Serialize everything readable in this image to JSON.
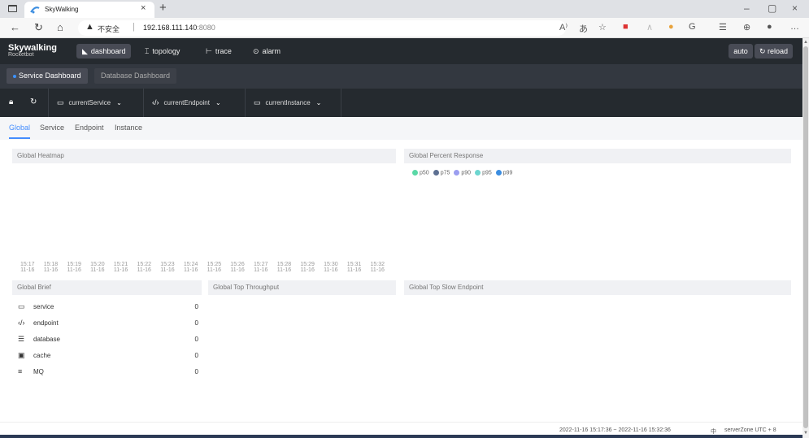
{
  "browser": {
    "tab_title": "SkyWalking",
    "url_warning": "不安全",
    "url_host": "192.168.111.140",
    "url_port": ":8080"
  },
  "app": {
    "logo_title": "Skywalking",
    "logo_subtitle": "Rocketbot",
    "nav": [
      {
        "label": "dashboard",
        "icon": "dashboard-icon"
      },
      {
        "label": "topology",
        "icon": "topology-icon"
      },
      {
        "label": "trace",
        "icon": "trace-icon"
      },
      {
        "label": "alarm",
        "icon": "alarm-icon"
      }
    ],
    "auto_label": "auto",
    "reload_label": "reload"
  },
  "dashboard_tabs": [
    "Service Dashboard",
    "Database Dashboard"
  ],
  "toolbar": {
    "service": "currentService",
    "endpoint": "currentEndpoint",
    "instance": "currentInstance"
  },
  "content_tabs": [
    "Global",
    "Service",
    "Endpoint",
    "Instance"
  ],
  "panels": {
    "heatmap": "Global Heatmap",
    "percent": "Global Percent Response",
    "brief": "Global Brief",
    "throughput": "Global Top Throughput",
    "slow": "Global Top Slow Endpoint"
  },
  "heatmap_times": [
    {
      "t": "15:17",
      "d": "11-16"
    },
    {
      "t": "15:18",
      "d": "11-16"
    },
    {
      "t": "15:19",
      "d": "11-16"
    },
    {
      "t": "15:20",
      "d": "11-16"
    },
    {
      "t": "15:21",
      "d": "11-16"
    },
    {
      "t": "15:22",
      "d": "11-16"
    },
    {
      "t": "15:23",
      "d": "11-16"
    },
    {
      "t": "15:24",
      "d": "11-16"
    },
    {
      "t": "15:25",
      "d": "11-16"
    },
    {
      "t": "15:26",
      "d": "11-16"
    },
    {
      "t": "15:27",
      "d": "11-16"
    },
    {
      "t": "15:28",
      "d": "11-16"
    },
    {
      "t": "15:29",
      "d": "11-16"
    },
    {
      "t": "15:30",
      "d": "11-16"
    },
    {
      "t": "15:31",
      "d": "11-16"
    },
    {
      "t": "15:32",
      "d": "11-16"
    }
  ],
  "legend": [
    {
      "name": "p50",
      "color": "#5ad8a6"
    },
    {
      "name": "p75",
      "color": "#5d7092"
    },
    {
      "name": "p90",
      "color": "#9b9ef0"
    },
    {
      "name": "p95",
      "color": "#6dd6d0"
    },
    {
      "name": "p99",
      "color": "#3b8de0"
    }
  ],
  "brief": [
    {
      "label": "service",
      "value": "0",
      "icon": "service-icon"
    },
    {
      "label": "endpoint",
      "value": "0",
      "icon": "endpoint-icon"
    },
    {
      "label": "database",
      "value": "0",
      "icon": "database-icon"
    },
    {
      "label": "cache",
      "value": "0",
      "icon": "cache-icon"
    },
    {
      "label": "MQ",
      "value": "0",
      "icon": "mq-icon"
    }
  ],
  "footer": {
    "range": "2022-11-16 15:17:36 ~ 2022-11-16 15:32:36",
    "lang": "中",
    "zone": "serverZone UTC + 8"
  }
}
